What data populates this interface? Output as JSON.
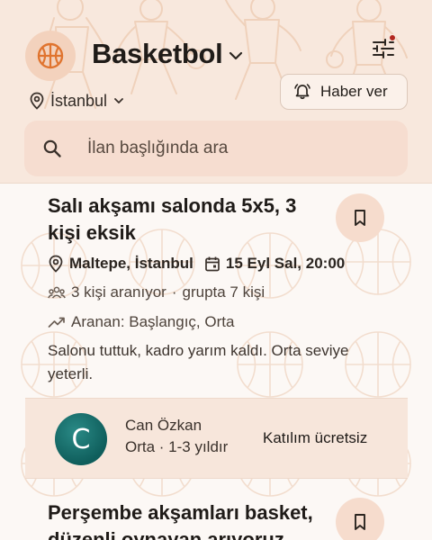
{
  "header": {
    "sport_icon": "basketball-icon",
    "title": "Basketbol",
    "title_dropdown_icon": "chevron-down-icon",
    "filter_icon": "tune-icon",
    "filter_badge_color": "#b3261e",
    "location": {
      "icon": "location-pin-icon",
      "label": "İstanbul",
      "dropdown_icon": "chevron-down-icon"
    },
    "notify": {
      "icon": "bell-alert-icon",
      "label": "Haber ver"
    }
  },
  "search": {
    "icon": "search-icon",
    "placeholder": "İlan başlığında ara"
  },
  "colors": {
    "accent": "#e0742f",
    "header_bg": "#f8e8dd",
    "avatar_bg": "#1a6f6c",
    "alert_dot": "#b3261e"
  },
  "listings": [
    {
      "title": "Salı akşamı salonda 5x5, 3 kişi eksik",
      "bookmark_icon": "bookmark-icon",
      "location": "Maltepe, İstanbul",
      "location_icon": "location-pin-icon",
      "datetime": "15 Eyl Sal, 20:00",
      "datetime_icon": "calendar-icon",
      "needed": "3 kişi aranıyor",
      "needed_icon": "group-icon",
      "separator": "·",
      "group_size": "grupta 7 kişi",
      "level": "Aranan: Başlangıç, Orta",
      "level_icon": "trending-up-icon",
      "description": "Salonu tuttuk, kadro yarım kaldı. Orta seviye yeterli.",
      "poster": {
        "initial": "C",
        "name": "Can Özkan",
        "level": "Orta · 1-3 yıldır",
        "fee": "Katılım ücretsiz"
      }
    },
    {
      "title": "Perşembe akşamları basket, düzenli oynayan arıyoruz",
      "bookmark_icon": "bookmark-icon"
    }
  ]
}
